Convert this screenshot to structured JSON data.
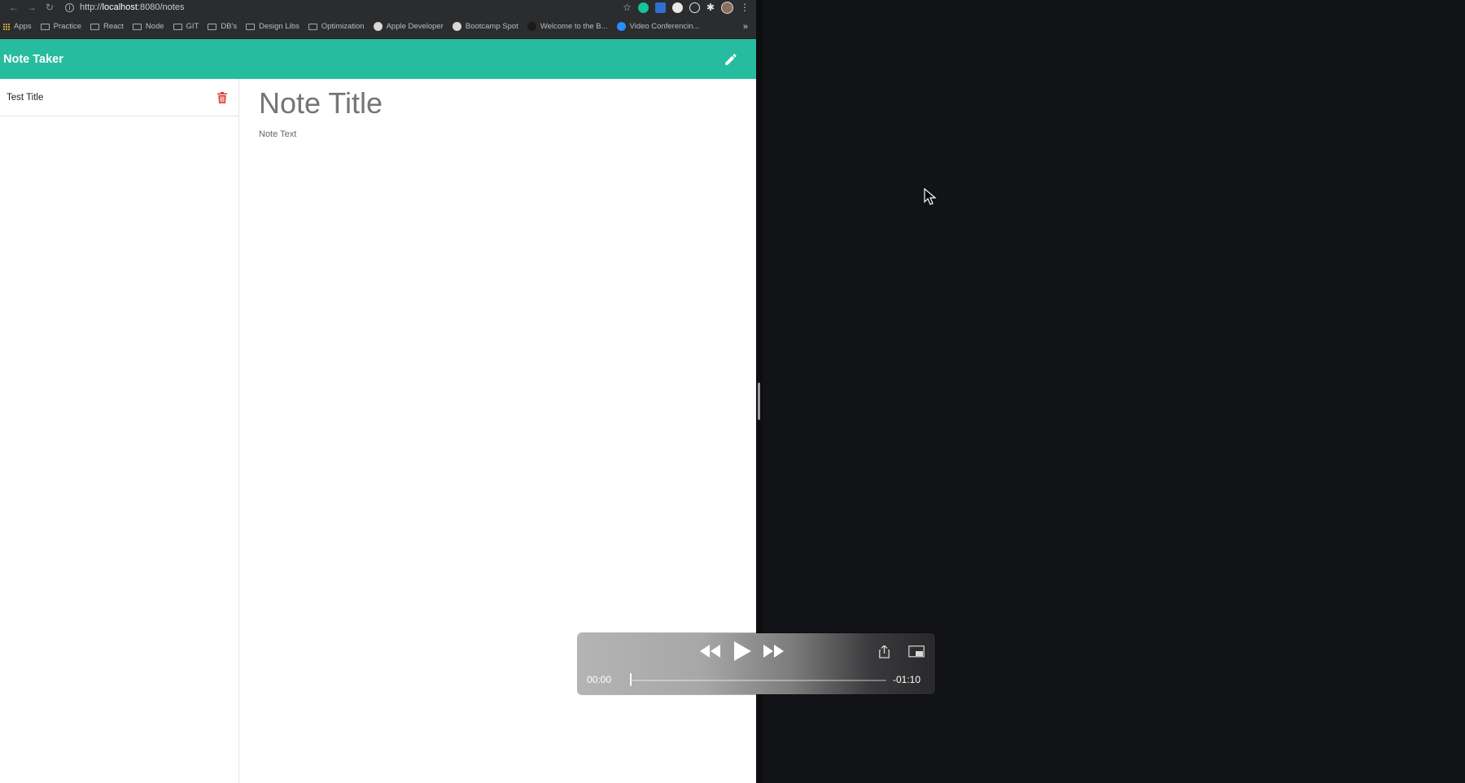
{
  "browser": {
    "url_prefix": "http://",
    "url_host": "localhost",
    "url_path": ":8080/notes"
  },
  "bookmarks": [
    {
      "label": "Apps",
      "icon": "apps-grid-icon"
    },
    {
      "label": "Practice",
      "icon": "folder-icon"
    },
    {
      "label": "React",
      "icon": "folder-icon"
    },
    {
      "label": "Node",
      "icon": "folder-icon"
    },
    {
      "label": "GIT",
      "icon": "folder-icon"
    },
    {
      "label": "DB's",
      "icon": "folder-icon"
    },
    {
      "label": "Design Libs",
      "icon": "folder-icon"
    },
    {
      "label": "Optimization",
      "icon": "folder-icon"
    },
    {
      "label": "Apple Developer",
      "icon": "apple-icon"
    },
    {
      "label": "Bootcamp Spot",
      "icon": "globe-icon"
    },
    {
      "label": "Welcome to the B...",
      "icon": "site-icon"
    },
    {
      "label": "Video Conferencin...",
      "icon": "zoom-icon"
    }
  ],
  "bookmarks_more": "»",
  "app": {
    "title": "Note Taker",
    "accent_color": "#26bc9f"
  },
  "notes": [
    {
      "title": "Test Title"
    }
  ],
  "editor": {
    "title_placeholder": "Note Title",
    "text_placeholder": "Note Text"
  },
  "player": {
    "current_time": "00:00",
    "remaining_time": "-01:10",
    "progress": 0
  }
}
